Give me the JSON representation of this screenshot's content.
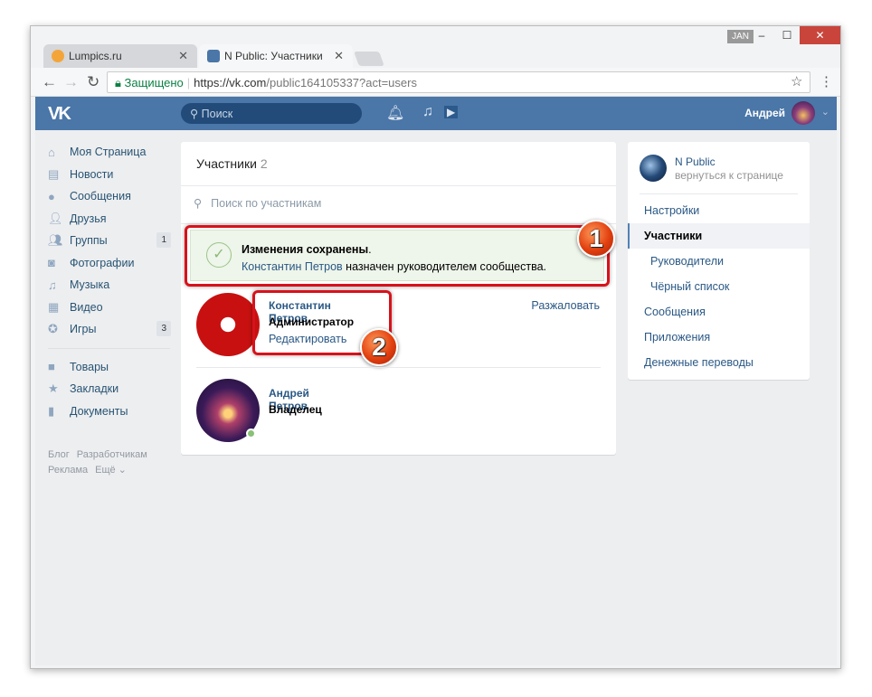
{
  "browser": {
    "tabs": [
      {
        "label": "Lumpics.ru"
      },
      {
        "label": "N Public: Участники"
      }
    ],
    "profile_badge": "JAN",
    "secure_label": "Защищено",
    "url_host": "https://vk.com",
    "url_path": "/public164105337?act=users"
  },
  "header": {
    "logo": "VK",
    "search_placeholder": "Поиск",
    "user_name": "Андрей"
  },
  "sidebar": {
    "items": [
      {
        "label": "Моя Страница",
        "icon": "home-icon"
      },
      {
        "label": "Новости",
        "icon": "news-icon"
      },
      {
        "label": "Сообщения",
        "icon": "messages-icon"
      },
      {
        "label": "Друзья",
        "icon": "friends-icon"
      },
      {
        "label": "Группы",
        "icon": "groups-icon",
        "count": "1"
      },
      {
        "label": "Фотографии",
        "icon": "camera-icon"
      },
      {
        "label": "Музыка",
        "icon": "music-icon"
      },
      {
        "label": "Видео",
        "icon": "video-icon"
      },
      {
        "label": "Игры",
        "icon": "gamepad-icon",
        "count": "3"
      }
    ],
    "items2": [
      {
        "label": "Товары",
        "icon": "bag-icon"
      },
      {
        "label": "Закладки",
        "icon": "star-icon"
      },
      {
        "label": "Документы",
        "icon": "document-icon"
      }
    ],
    "footer": [
      "Блог",
      "Разработчикам",
      "Реклама",
      "Ещё ⌄"
    ]
  },
  "main": {
    "title": "Участники",
    "count": "2",
    "search_placeholder": "Поиск по участникам",
    "notice": {
      "title": "Изменения сохранены",
      "title_end": ".",
      "link": "Константин Петров",
      "text": " назначен руководителем сообщества."
    },
    "members": [
      {
        "name": "Константин Петров",
        "role": "Администратор",
        "edit": "Редактировать",
        "action": "Разжаловать"
      },
      {
        "name": "Андрей Петров",
        "role": "Владелец"
      }
    ],
    "callouts": [
      "1",
      "2"
    ]
  },
  "right": {
    "group_name": "N Public",
    "back": "вернуться к странице",
    "menu": [
      "Настройки",
      "Участники",
      "Руководители",
      "Чёрный список",
      "Сообщения",
      "Приложения",
      "Денежные переводы"
    ]
  }
}
